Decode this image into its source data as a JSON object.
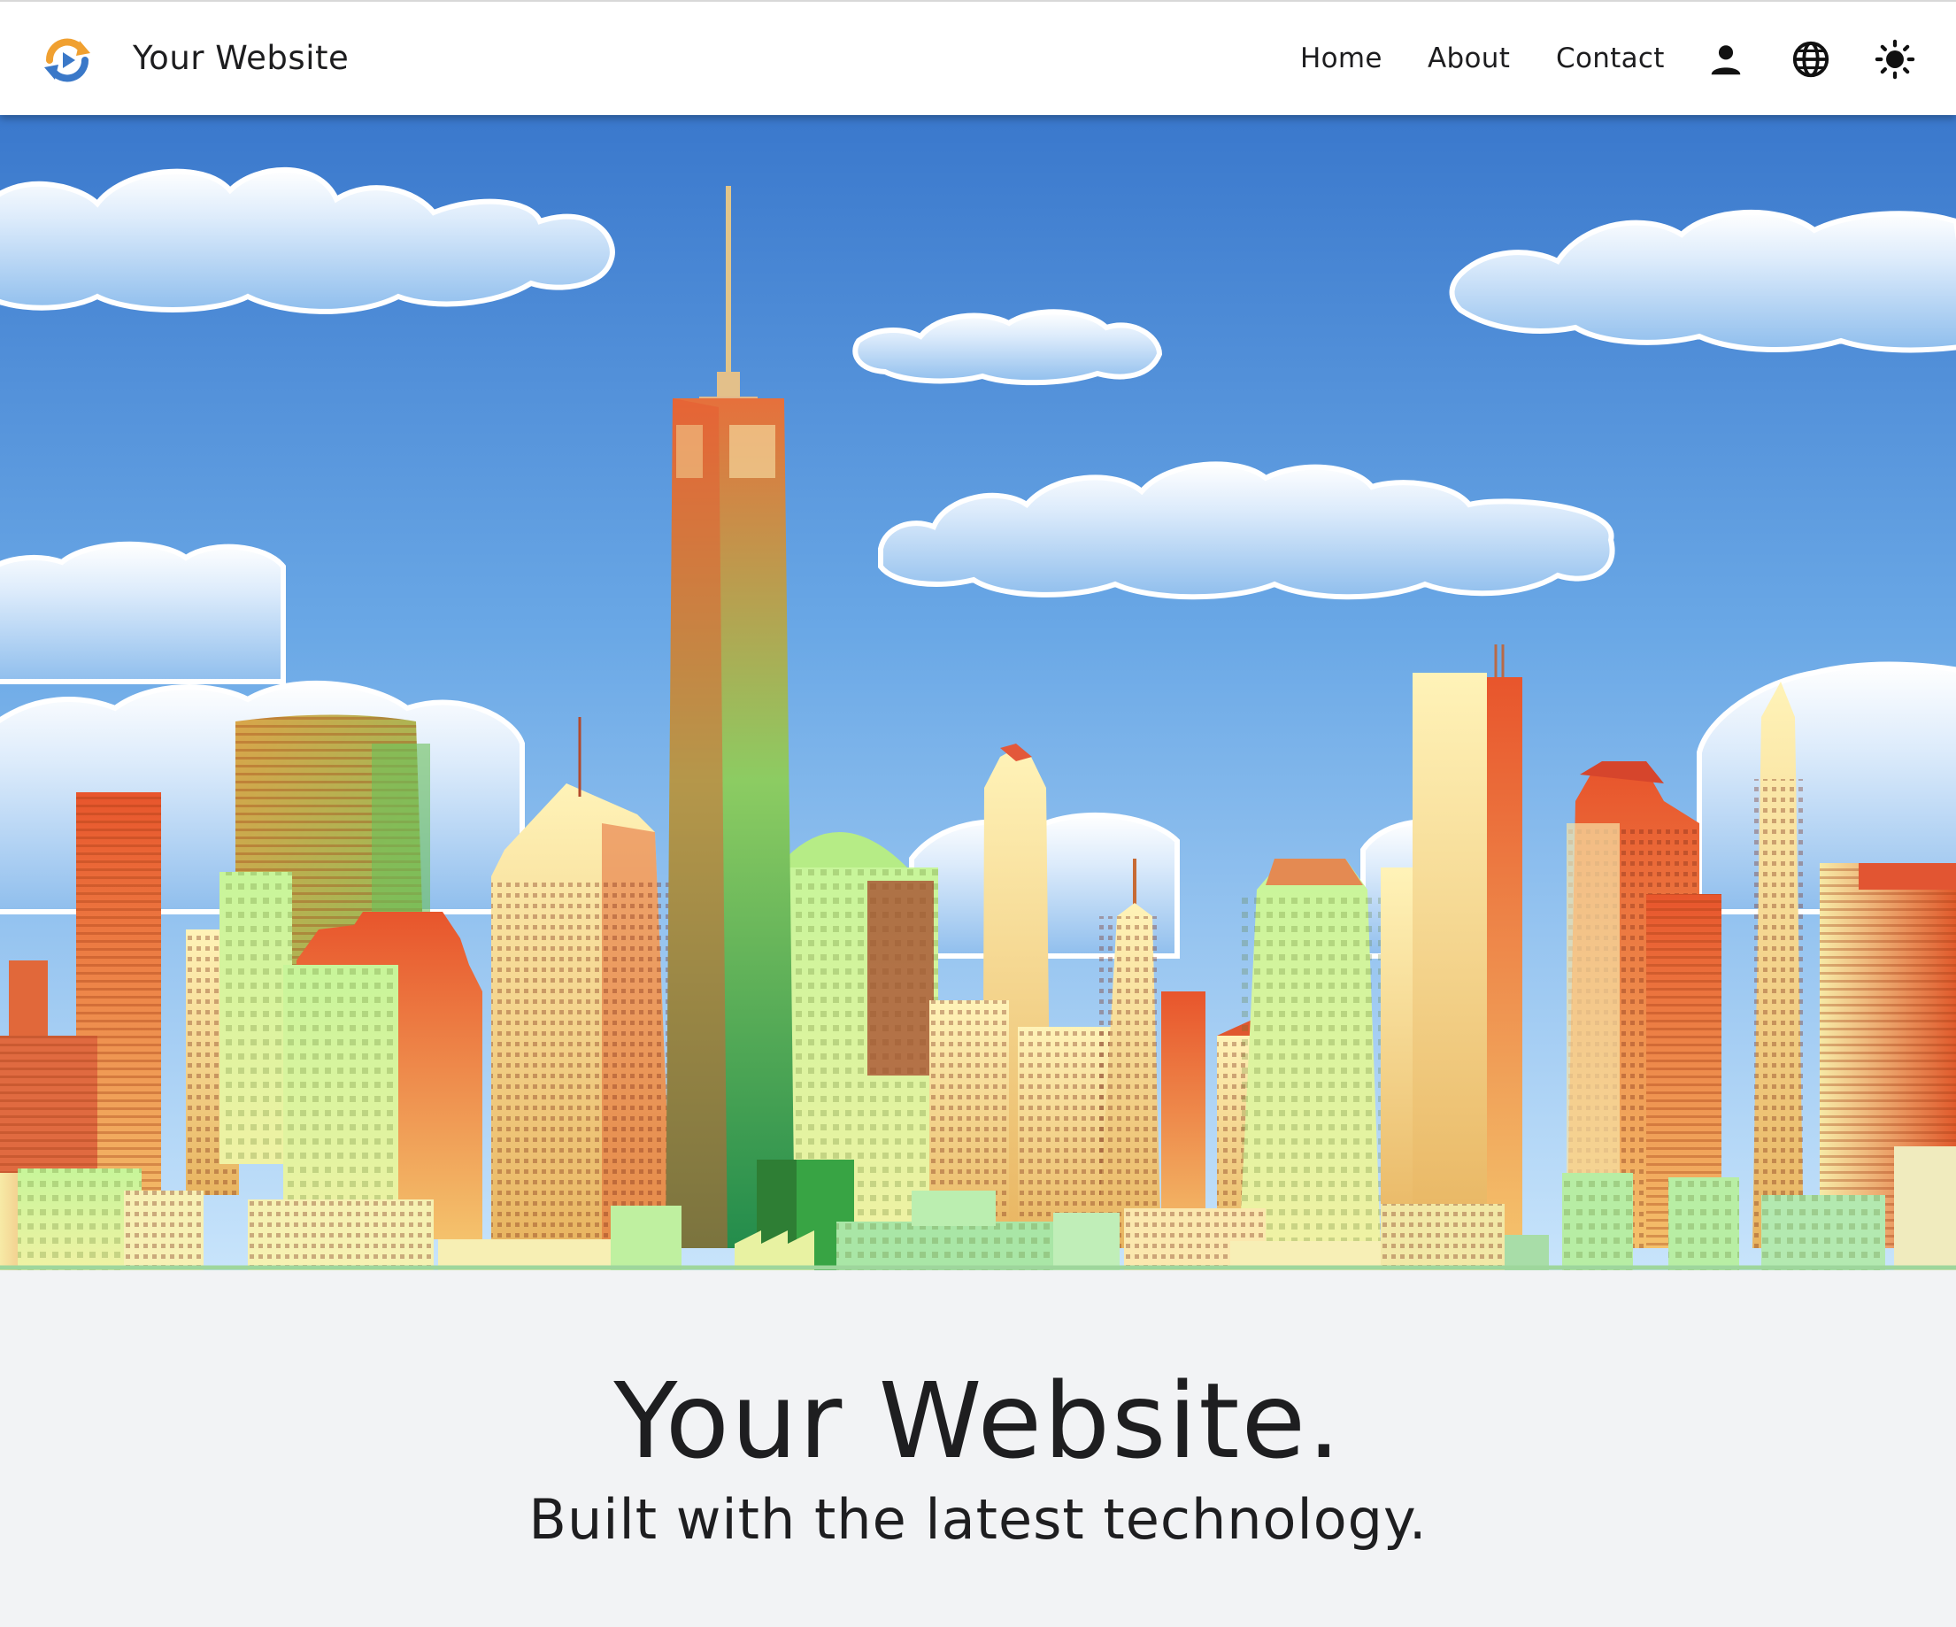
{
  "header": {
    "brand_name": "Your Website",
    "brand_logo_icon": "refresh-play-logo",
    "nav": [
      {
        "label": "Home"
      },
      {
        "label": "About"
      },
      {
        "label": "Contact"
      }
    ],
    "icons": [
      "person-icon",
      "globe-icon",
      "sun-icon"
    ]
  },
  "hero": {
    "image_subject": "city-skyline-illustration",
    "sky_color": "#3f7fd0"
  },
  "main": {
    "title": "Your Website.",
    "subtitle": "Built with the latest technology."
  },
  "colors": {
    "text": "#1e1e20",
    "navbar_bg": "#ffffff",
    "page_bg": "#f2f3f5",
    "logo_orange": "#f0a030",
    "logo_blue": "#3a78c8"
  }
}
